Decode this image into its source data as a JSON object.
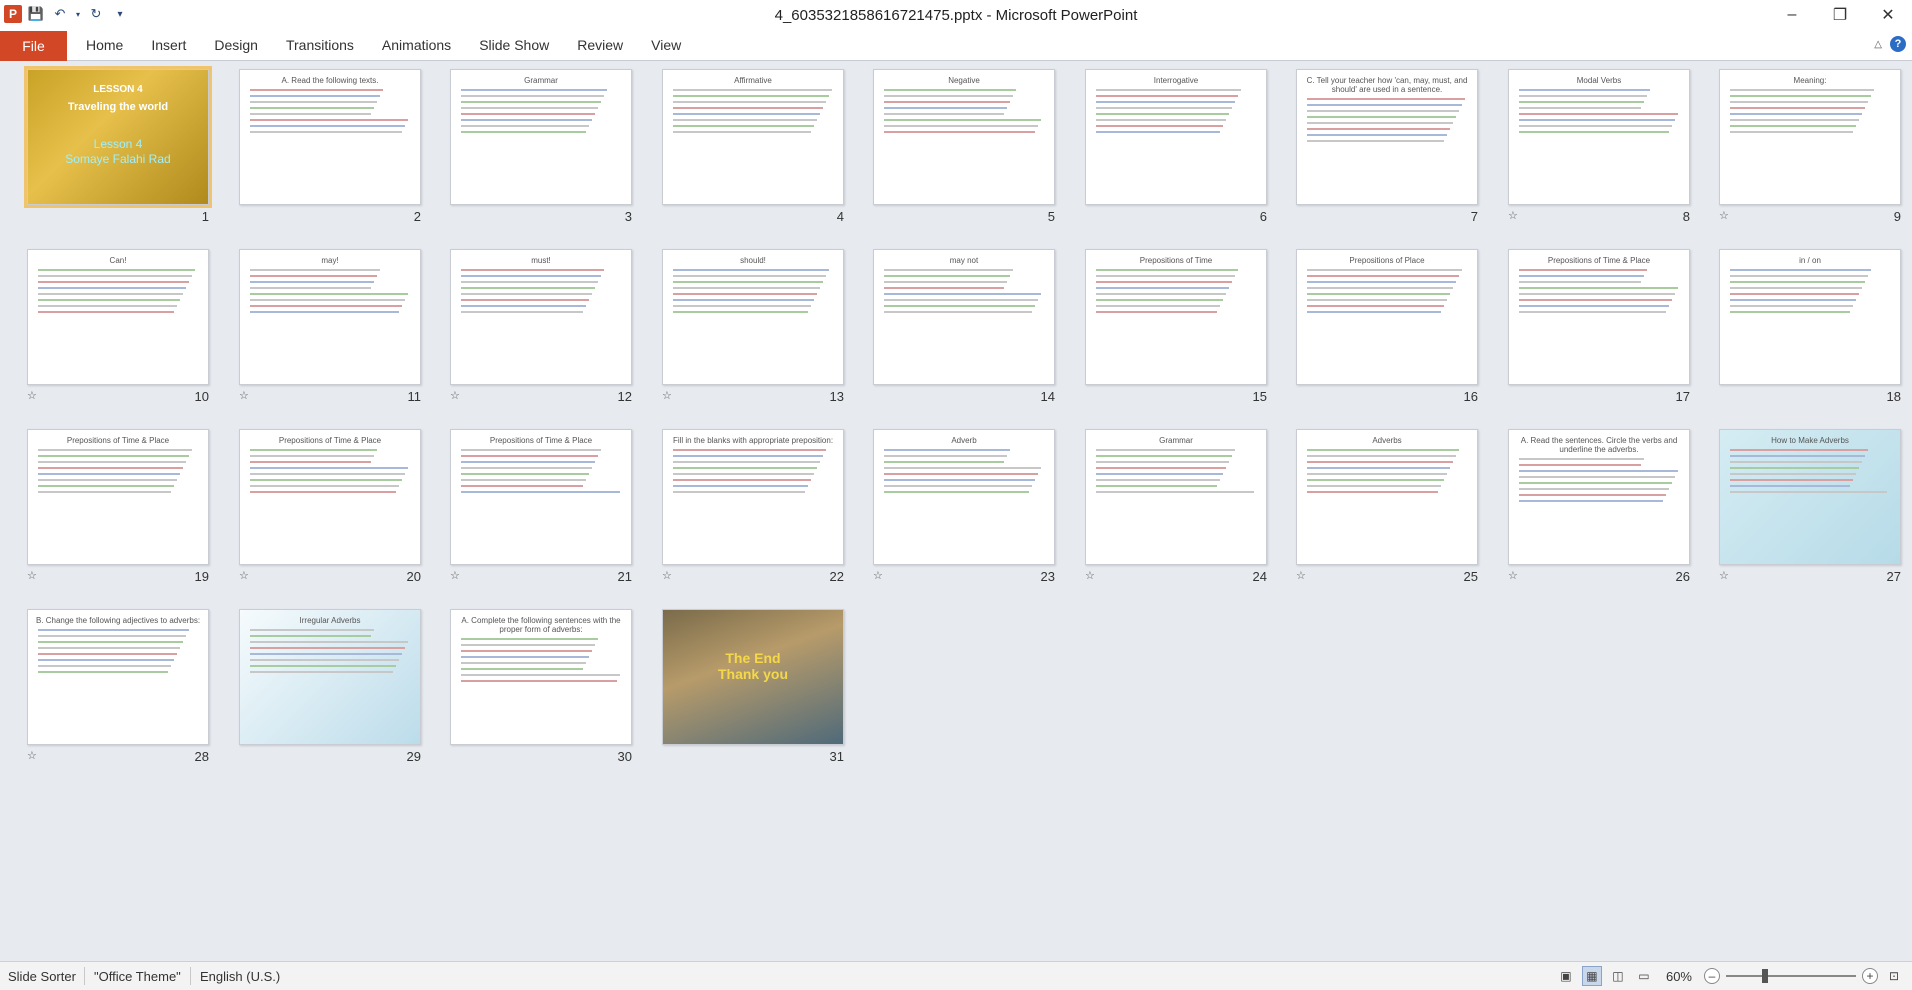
{
  "window": {
    "title": "4_6035321858616721475.pptx - Microsoft PowerPoint"
  },
  "ribbon": {
    "file_tab": "File",
    "tabs": [
      "Home",
      "Insert",
      "Design",
      "Transitions",
      "Animations",
      "Slide Show",
      "Review",
      "View"
    ]
  },
  "slides": [
    {
      "num": "1",
      "title": "LESSON 4",
      "subtitle": "Traveling the world",
      "caption": "Lesson 4\nSomaye Falahi Rad",
      "transition": false
    },
    {
      "num": "2",
      "title": "A. Read the following texts.",
      "transition": false
    },
    {
      "num": "3",
      "title": "Grammar",
      "transition": false
    },
    {
      "num": "4",
      "title": "Affirmative",
      "transition": false
    },
    {
      "num": "5",
      "title": "Negative",
      "transition": false
    },
    {
      "num": "6",
      "title": "Interrogative",
      "transition": false
    },
    {
      "num": "7",
      "title": "C. Tell your teacher how 'can, may, must, and should' are used in a sentence.",
      "transition": false
    },
    {
      "num": "8",
      "title": "Modal Verbs",
      "transition": true
    },
    {
      "num": "9",
      "title": "Meaning:",
      "transition": true
    },
    {
      "num": "10",
      "title": "Can!",
      "transition": true
    },
    {
      "num": "11",
      "title": "may!",
      "transition": true
    },
    {
      "num": "12",
      "title": "must!",
      "transition": true
    },
    {
      "num": "13",
      "title": "should!",
      "transition": true
    },
    {
      "num": "14",
      "title": "may not",
      "transition": false
    },
    {
      "num": "15",
      "title": "Prepositions of Time",
      "transition": false
    },
    {
      "num": "16",
      "title": "Prepositions of Place",
      "transition": false
    },
    {
      "num": "17",
      "title": "Prepositions of Time & Place",
      "transition": false
    },
    {
      "num": "18",
      "title": "in / on",
      "transition": false
    },
    {
      "num": "19",
      "title": "Prepositions of Time & Place",
      "transition": true
    },
    {
      "num": "20",
      "title": "Prepositions of Time & Place",
      "transition": true
    },
    {
      "num": "21",
      "title": "Prepositions of Time & Place",
      "transition": true
    },
    {
      "num": "22",
      "title": "Fill in the blanks with appropriate preposition:",
      "transition": true
    },
    {
      "num": "23",
      "title": "Adverb",
      "transition": true
    },
    {
      "num": "24",
      "title": "Grammar",
      "transition": true
    },
    {
      "num": "25",
      "title": "Adverbs",
      "transition": true
    },
    {
      "num": "26",
      "title": "A. Read the sentences. Circle the verbs and underline the adverbs.",
      "transition": true
    },
    {
      "num": "27",
      "title": "How to Make Adverbs",
      "transition": true
    },
    {
      "num": "28",
      "title": "B. Change the following adjectives to adverbs:",
      "transition": true
    },
    {
      "num": "29",
      "title": "Irregular Adverbs",
      "transition": false
    },
    {
      "num": "30",
      "title": "A. Complete the following sentences with the proper form of adverbs:",
      "transition": false
    },
    {
      "num": "31",
      "title": "The End\nThank you",
      "transition": false
    }
  ],
  "statusbar": {
    "view": "Slide Sorter",
    "theme": "\"Office Theme\"",
    "language": "English (U.S.)",
    "zoom": "60%"
  }
}
